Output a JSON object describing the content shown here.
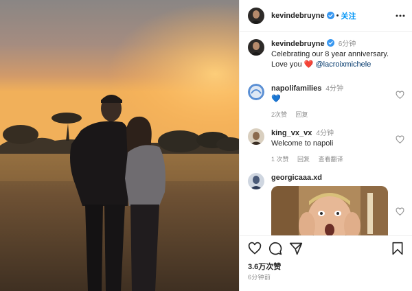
{
  "header": {
    "username": "kevindebruyne",
    "separator": "•",
    "follow_label": "关注"
  },
  "caption": {
    "username": "kevindebruyne",
    "time": "6分钟",
    "text": "Celebrating our 8 year anniversary. Love you",
    "emoji": "❤️",
    "mention": "@lacroixmichele"
  },
  "comments": [
    {
      "username": "napolifamilies",
      "time": "4分钟",
      "text": "💙",
      "likes": "2次赞",
      "reply_label": "回复"
    },
    {
      "username": "king_vx_vx",
      "time": "4分钟",
      "text": "Welcome to napoli",
      "likes": "1 次赞",
      "reply_label": "回复",
      "translate_label": "查看翻译"
    },
    {
      "username": "georgicaaa.xd",
      "media": "reaction-gif"
    }
  ],
  "footer": {
    "likes": "3.6万次赞",
    "posted": "6分钟前"
  },
  "icons": {
    "verified": "verified-badge-icon",
    "more": "more-options-icon",
    "like": "heart-outline-icon",
    "comment": "comment-bubble-icon",
    "share": "paper-plane-icon",
    "save": "bookmark-icon"
  },
  "colors": {
    "accent": "#0095f6",
    "verified": "#3897f0",
    "text": "#262626",
    "muted": "#8e8e8e",
    "mention": "#00376b",
    "heart": "#ed4956",
    "blue_heart": "#3b82f6"
  }
}
